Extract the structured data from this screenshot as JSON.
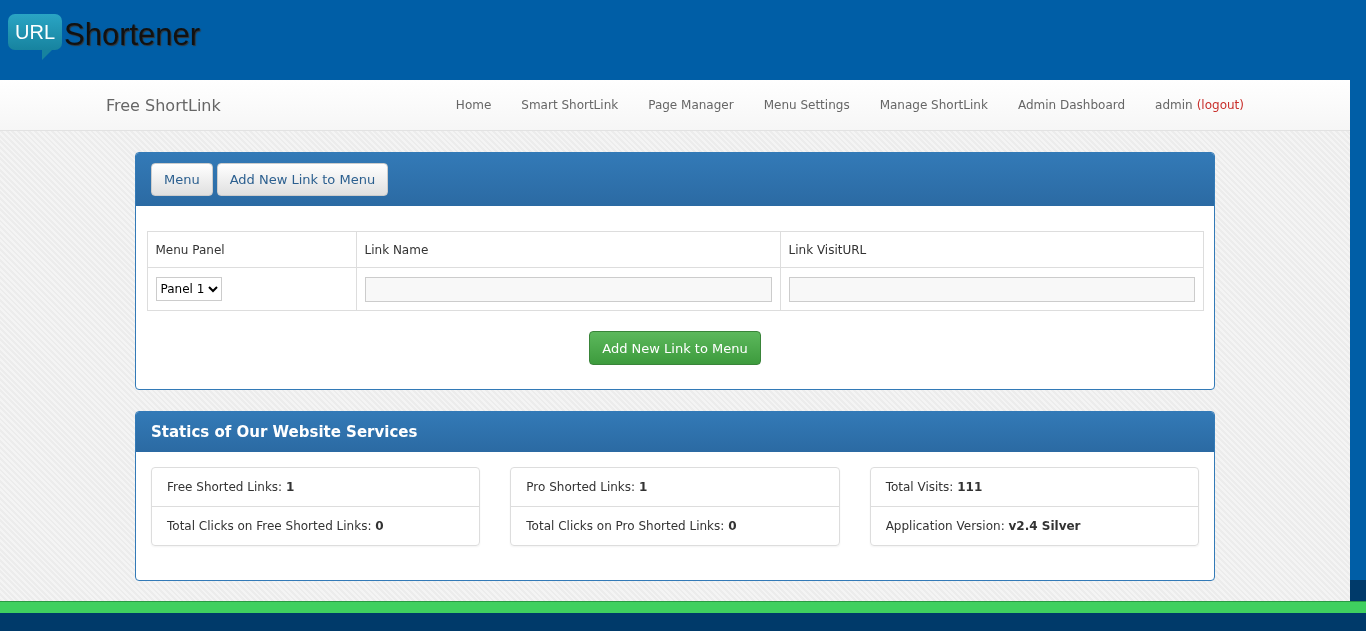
{
  "logo": {
    "badge": "URL",
    "text": "Shortener"
  },
  "navbar": {
    "brand": "Free ShortLink",
    "items": [
      {
        "label": "Home"
      },
      {
        "label": "Smart ShortLink"
      },
      {
        "label": "Page Manager"
      },
      {
        "label": "Menu Settings"
      },
      {
        "label": "Manage ShortLink"
      },
      {
        "label": "Admin Dashboard"
      }
    ],
    "user": "admin",
    "logout": "(logout)"
  },
  "menu_panel": {
    "tabs": [
      "Menu",
      "Add New Link to Menu"
    ],
    "columns": [
      "Menu Panel",
      "Link Name",
      "Link VisitURL"
    ],
    "panel_select": "Panel 1",
    "submit": "Add New Link to Menu"
  },
  "stats_panel": {
    "title": "Statics of Our Website Services",
    "cards": [
      [
        "Free Shorted Links: **1**",
        "Total Clicks on Free Shorted Links: **0**"
      ],
      [
        "Pro Shorted Links: **1**",
        "Total Clicks on Pro Shorted Links: **0**"
      ],
      [
        "Total Visits: **111**",
        "Application Version: **v2.4 Silver**"
      ]
    ]
  }
}
